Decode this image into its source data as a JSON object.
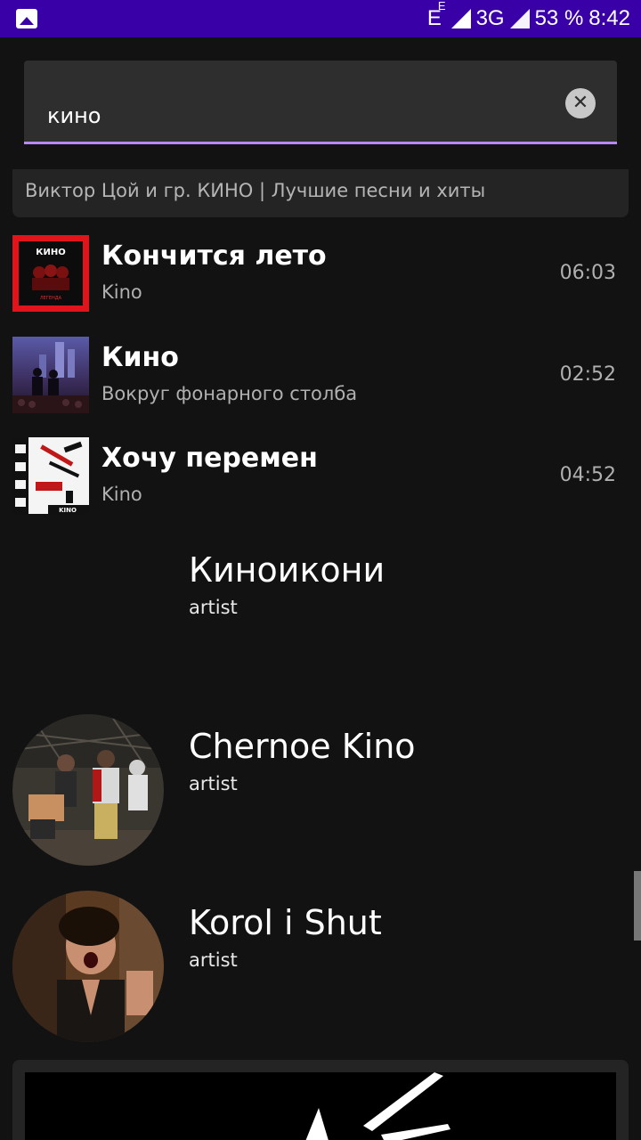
{
  "status": {
    "network_letter": "E",
    "network_small": "E",
    "network_type": "3G",
    "battery": "53 %",
    "time": "8:42"
  },
  "search": {
    "query": "кино",
    "clear_icon": "close-icon"
  },
  "playlist_card": {
    "subtitle": "Виктор Цой и гр. КИНО | Лучшие песни и хиты"
  },
  "tracks": [
    {
      "title": "Кончится лето",
      "artist": "Kino",
      "duration": "06:03"
    },
    {
      "title": "Кино",
      "artist": "Вокруг фонарного столба",
      "duration": "02:52"
    },
    {
      "title": "Хочу перемен",
      "artist": "Kino",
      "duration": "04:52"
    }
  ],
  "artists": [
    {
      "name": "Киноикони",
      "type": "artist"
    },
    {
      "name": "Chernoe Kino",
      "type": "artist"
    },
    {
      "name": "Korol i Shut",
      "type": "artist"
    }
  ],
  "colors": {
    "status_bar": "#3a00a8",
    "accent": "#b888ff",
    "background": "#121212"
  }
}
